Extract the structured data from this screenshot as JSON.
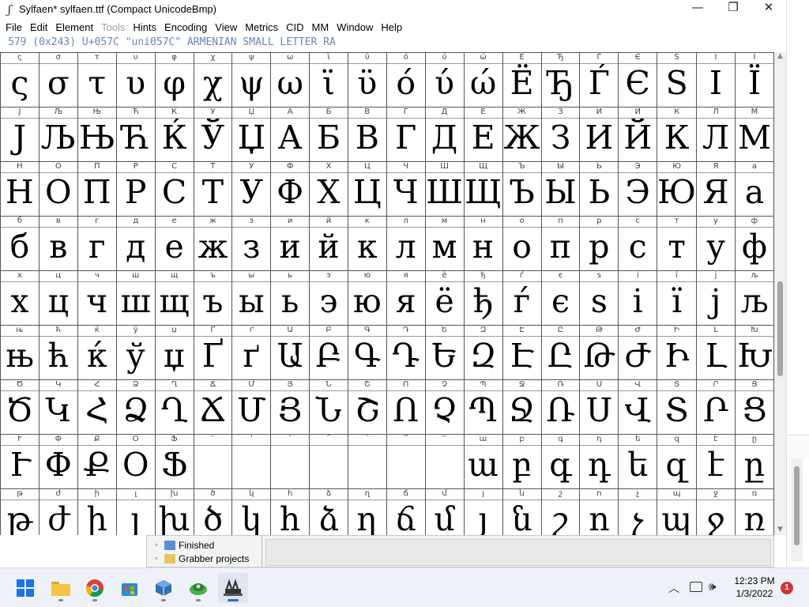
{
  "window": {
    "title": "Sylfaen* sylfaen.ttf (Compact UnicodeBmp)",
    "icon": "feather-icon",
    "minimize": "—",
    "maximize": "❐",
    "close": "✕"
  },
  "menus": [
    "File",
    "Edit",
    "Element",
    "Tools",
    "Hints",
    "Encoding",
    "View",
    "Metrics",
    "CID",
    "MM",
    "Window",
    "Help"
  ],
  "disabled_menus": [
    "Tools"
  ],
  "info_bar": "579 (0x243) U+057C \"uni057C\" ARMENIAN SMALL LETTER RA",
  "grid": {
    "rows": [
      {
        "glyphs": [
          "ς",
          "σ",
          "τ",
          "υ",
          "φ",
          "χ",
          "ψ",
          "ω",
          "ϊ",
          "ϋ",
          "ό",
          "ύ",
          "ώ",
          "Ё",
          "Ђ",
          "Ѓ",
          "Є",
          "Ѕ",
          "І",
          "Ї"
        ]
      },
      {
        "glyphs": [
          "Ј",
          "Љ",
          "Њ",
          "Ћ",
          "Ќ",
          "Ў",
          "Џ",
          "А",
          "Б",
          "В",
          "Г",
          "Д",
          "Е",
          "Ж",
          "З",
          "И",
          "Й",
          "К",
          "Л",
          "М"
        ]
      },
      {
        "glyphs": [
          "Н",
          "О",
          "П",
          "Р",
          "С",
          "Т",
          "У",
          "Ф",
          "Х",
          "Ц",
          "Ч",
          "Ш",
          "Щ",
          "Ъ",
          "Ы",
          "Ь",
          "Э",
          "Ю",
          "Я",
          "а"
        ]
      },
      {
        "glyphs": [
          "б",
          "в",
          "г",
          "д",
          "е",
          "ж",
          "з",
          "и",
          "й",
          "к",
          "л",
          "м",
          "н",
          "о",
          "п",
          "р",
          "с",
          "т",
          "у",
          "ф"
        ]
      },
      {
        "glyphs": [
          "х",
          "ц",
          "ч",
          "ш",
          "щ",
          "ъ",
          "ы",
          "ь",
          "э",
          "ю",
          "я",
          "ё",
          "ђ",
          "ѓ",
          "є",
          "ѕ",
          "і",
          "ї",
          "ј",
          "љ"
        ]
      },
      {
        "glyphs": [
          "њ",
          "ћ",
          "ќ",
          "ў",
          "џ",
          "Ґ",
          "ґ",
          "Ա",
          "Բ",
          "Գ",
          "Դ",
          "Ե",
          "Զ",
          "Է",
          "Ը",
          "Թ",
          "Ժ",
          "Ի",
          "Լ",
          "Խ"
        ]
      },
      {
        "glyphs": [
          "Ծ",
          "Կ",
          "Հ",
          "Ձ",
          "Ղ",
          "Ճ",
          "Մ",
          "Յ",
          "Ն",
          "Շ",
          "Ո",
          "Չ",
          "Պ",
          "Ջ",
          "Ռ",
          "Ս",
          "Վ",
          "Տ",
          "Ր",
          "Ց"
        ]
      },
      {
        "glyphs": [
          "Ւ",
          "Փ",
          "Ք",
          "Օ",
          "Ֆ",
          "",
          "",
          "",
          "",
          "",
          "",
          "",
          "ա",
          "բ",
          "գ",
          "դ",
          "ե",
          "զ",
          "է",
          "ը"
        ]
      },
      {
        "glyphs": [
          "թ",
          "ժ",
          "ի",
          "լ",
          "խ",
          "ծ",
          "կ",
          "հ",
          "ձ",
          "ղ",
          "ճ",
          "մ",
          "յ",
          "ն",
          "շ",
          "ո",
          "չ",
          "պ",
          "ջ",
          "ռ"
        ]
      }
    ],
    "labels": [
      [
        "ς",
        "σ",
        "τ",
        "υ",
        "φ",
        "χ",
        "ψ",
        "ω",
        "ϊ",
        "ϋ",
        "ό",
        "ύ",
        "ώ",
        "Ё",
        "Ђ",
        "Ѓ",
        "Є",
        "Ѕ",
        "І",
        "Ї"
      ],
      [
        "Ј",
        "Љ",
        "Њ",
        "Ћ",
        "Ќ",
        "Ў",
        "Џ",
        "А",
        "Б",
        "В",
        "Г",
        "Д",
        "Е",
        "Ж",
        "З",
        "И",
        "Й",
        "К",
        "Л",
        "М"
      ],
      [
        "Н",
        "О",
        "П",
        "Р",
        "С",
        "Т",
        "У",
        "Ф",
        "Х",
        "Ц",
        "Ч",
        "Ш",
        "Щ",
        "Ъ",
        "Ы",
        "Ь",
        "Э",
        "Ю",
        "Я",
        "а"
      ],
      [
        "б",
        "в",
        "г",
        "д",
        "е",
        "ж",
        "з",
        "и",
        "й",
        "к",
        "л",
        "м",
        "н",
        "о",
        "п",
        "р",
        "с",
        "т",
        "у",
        "ф"
      ],
      [
        "х",
        "ц",
        "ч",
        "ш",
        "щ",
        "ъ",
        "ы",
        "ь",
        "э",
        "ю",
        "я",
        "ё",
        "ђ",
        "ѓ",
        "є",
        "ѕ",
        "і",
        "ї",
        "ј",
        "љ"
      ],
      [
        "њ",
        "ћ",
        "ќ",
        "ў",
        "џ",
        "Ґ",
        "ґ",
        "Ա",
        "Բ",
        "Գ",
        "Դ",
        "Ե",
        "Զ",
        "Է",
        "Ը",
        "Թ",
        "Ժ",
        "Ի",
        "Լ",
        "Խ"
      ],
      [
        "Ծ",
        "Կ",
        "Հ",
        "Ձ",
        "Ղ",
        "Ճ",
        "Մ",
        "Յ",
        "Ն",
        "Շ",
        "Ո",
        "Չ",
        "Պ",
        "Ջ",
        "Ռ",
        "Ս",
        "Վ",
        "Տ",
        "Ր",
        "Ց"
      ],
      [
        "Ւ",
        "Փ",
        "Ք",
        "Օ",
        "Ֆ",
        "ՙ",
        "՚",
        "՛",
        "՜",
        "՝",
        "՞",
        "՟",
        "ա",
        "բ",
        "գ",
        "դ",
        "ե",
        "զ",
        "է",
        "ը"
      ],
      [
        "թ",
        "ժ",
        "ի",
        "լ",
        "խ",
        "ծ",
        "կ",
        "հ",
        "ձ",
        "ղ",
        "ճ",
        "մ",
        "յ",
        "ն",
        "շ",
        "ո",
        "չ",
        "պ",
        "ջ",
        "ռ"
      ]
    ]
  },
  "background_window": {
    "items": [
      "Finished",
      "Grabber projects"
    ]
  },
  "taskbar": {
    "apps": [
      "windows-start-icon",
      "file-explorer-icon",
      "chrome-icon",
      "microsoft-store-icon",
      "virtualbox-icon",
      "network-app-icon",
      "fontforge-icon"
    ],
    "active_index": 6
  },
  "tray": {
    "chevron": "︿",
    "volume": "🕪",
    "time": "12:23 PM",
    "date": "1/3/2022",
    "notification_count": "1"
  }
}
